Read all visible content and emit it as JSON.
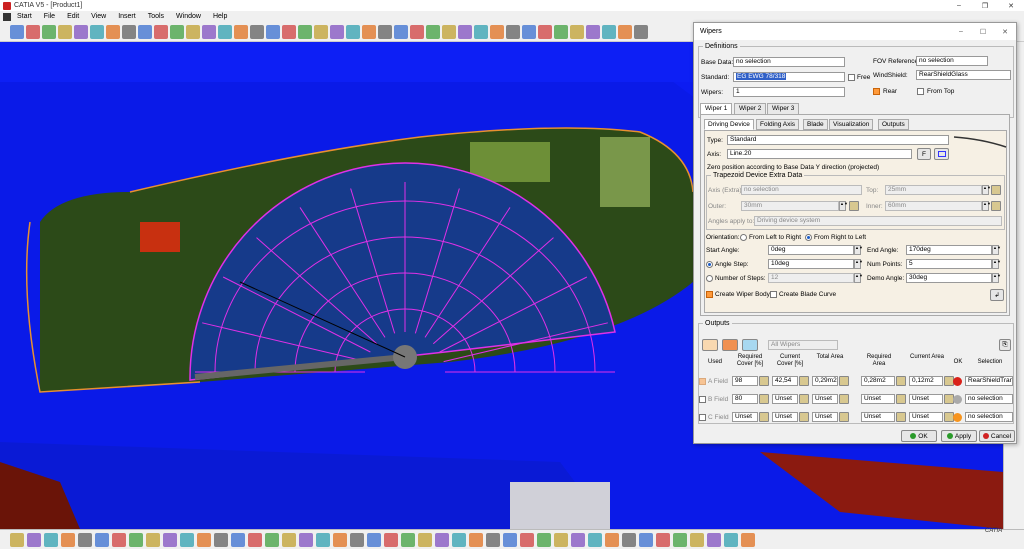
{
  "window": {
    "title": "CATIA V5 - [Product1]",
    "min": "–",
    "restore": "❐",
    "close": "✕"
  },
  "menu": [
    "Start",
    "File",
    "Edit",
    "View",
    "Insert",
    "Tools",
    "Window",
    "Help"
  ],
  "dialog": {
    "title": "Wipers",
    "min": "–",
    "max": "☐",
    "close": "✕",
    "definitions": {
      "legend": "Definitions",
      "base_data_label": "Base Data:",
      "base_data_value": "no selection",
      "standard_label": "Standard:",
      "standard_value": "EG EWG 78/318",
      "free_label": "Free",
      "wipers_label": "Wipers:",
      "wipers_value": "1",
      "fov_label": "FOV Reference:",
      "fov_value": "no selection",
      "windshield_label": "WindShield:",
      "windshield_value": "RearShieldGlass",
      "rear_label": "Rear",
      "from_top_label": "From Top"
    },
    "tabs": [
      "Wiper 1",
      "Wiper 2",
      "Wiper 3"
    ],
    "subtabs": [
      "Driving Device",
      "Folding Axis",
      "Blade",
      "Visualization",
      "Outputs"
    ],
    "driving": {
      "type_label": "Type:",
      "type_value": "Standard",
      "axis_label": "Axis:",
      "axis_value": "Line.20",
      "axis_btn": "F",
      "zero_text": "Zero position according to Base Data Y direction (projected)",
      "trap_legend": "Trapezoid Device Extra Data",
      "axis_extra_label": "Axis (Extra):",
      "axis_extra_value": "no selection",
      "top_label": "Top:",
      "top_value": "25mm",
      "outer_label": "Outer:",
      "outer_value": "30mm",
      "inner_label": "Inner:",
      "inner_value": "60mm",
      "angles_apply_label": "Angles apply to:",
      "angles_apply_value": "Driving device system",
      "orientation_label": "Orientation:",
      "orient_ltr": "From Left to Right",
      "orient_rtl": "From Right to Left",
      "start_angle_label": "Start Angle:",
      "start_angle_value": "0deg",
      "end_angle_label": "End Angle:",
      "end_angle_value": "170deg",
      "angle_step_label": "Angle Step:",
      "angle_step_value": "10deg",
      "num_points_label": "Num Points:",
      "num_points_value": "5",
      "num_steps_label": "Number of Steps:",
      "num_steps_value": "12",
      "demo_angle_label": "Demo Angle:",
      "demo_angle_value": "30deg",
      "create_body_label": "Create Wiper Body",
      "create_curve_label": "Create Blade Curve"
    },
    "outputs": {
      "legend": "Outputs",
      "all_wipers": "All Wipers",
      "headers": [
        "Used",
        "Required Cover [%]",
        "Current Cover [%]",
        "Total Area",
        "Required Area",
        "Current Area",
        "OK",
        "Selection"
      ],
      "rows": [
        {
          "field": "A Field",
          "req_cover": "98",
          "cur_cover": "42,54",
          "total": "0,29m2",
          "req_area": "0,28m2",
          "cur_area": "0,12m2",
          "selection": "RearShieldTrans",
          "status": "#d9221a"
        },
        {
          "field": "B Field",
          "req_cover": "80",
          "cur_cover": "Unset",
          "total": "Unset",
          "req_area": "Unset",
          "cur_area": "Unset",
          "selection": "no selection",
          "status": "#aaaaaa"
        },
        {
          "field": "C Field",
          "req_cover": "Unset",
          "cur_cover": "Unset",
          "total": "Unset",
          "req_area": "Unset",
          "cur_area": "Unset",
          "selection": "no selection",
          "status": "#f7941d"
        }
      ]
    },
    "buttons": {
      "ok": "OK",
      "apply": "Apply",
      "cancel": "Cancel"
    }
  },
  "colors": {
    "background": "#0c1cf2",
    "glass": "#2b4a1a",
    "wipe_area": "#163a8a",
    "grid": "#e030e8",
    "accent": "#ff9a3a"
  },
  "logo": "CATIA"
}
